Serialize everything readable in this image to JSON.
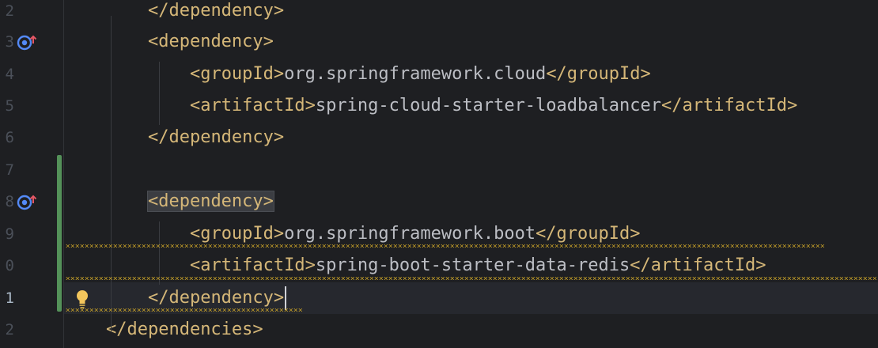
{
  "editor": {
    "lines": [
      {
        "number": "2",
        "prefix": "        ",
        "open": "</dependency>",
        "text": "",
        "close": ""
      },
      {
        "number": "3",
        "prefix": "        ",
        "open": "<dependency>",
        "text": "",
        "close": "",
        "mark": "implements-override-icon"
      },
      {
        "number": "4",
        "prefix": "            ",
        "open": "<groupId>",
        "text": "org.springframework.cloud",
        "close": "</groupId>"
      },
      {
        "number": "5",
        "prefix": "            ",
        "open": "<artifactId>",
        "text": "spring-cloud-starter-loadbalancer",
        "close": "</artifactId>"
      },
      {
        "number": "6",
        "prefix": "        ",
        "open": "</dependency>",
        "text": "",
        "close": ""
      },
      {
        "number": "7",
        "prefix": "",
        "open": "",
        "text": "",
        "close": ""
      },
      {
        "number": "8",
        "prefix": "        ",
        "open": "<dependency>",
        "text": "",
        "close": "",
        "mark": "implements-override-icon"
      },
      {
        "number": "9",
        "prefix": "            ",
        "open": "<groupId>",
        "text": "org.springframework.boot",
        "close": "</groupId>"
      },
      {
        "number": "0",
        "prefix": "            ",
        "open": "<artifactId>",
        "text": "spring-boot-starter-data-redis",
        "close": "</artifactId>"
      },
      {
        "number": "1",
        "prefix": "        ",
        "open": "</dependency>",
        "text": "",
        "close": "",
        "current": true
      },
      {
        "number": "2",
        "prefix": "    ",
        "open": "</dependencies>",
        "text": "",
        "close": ""
      }
    ]
  },
  "colors": {
    "background": "#1e1f22",
    "tag": "#d5b778",
    "text": "#bcbec4",
    "vcs_added": "#549159",
    "warning_squiggle": "#c9a227"
  },
  "icons": {
    "gutter_mark": "implements-override-icon",
    "intention": "lightbulb-icon"
  }
}
